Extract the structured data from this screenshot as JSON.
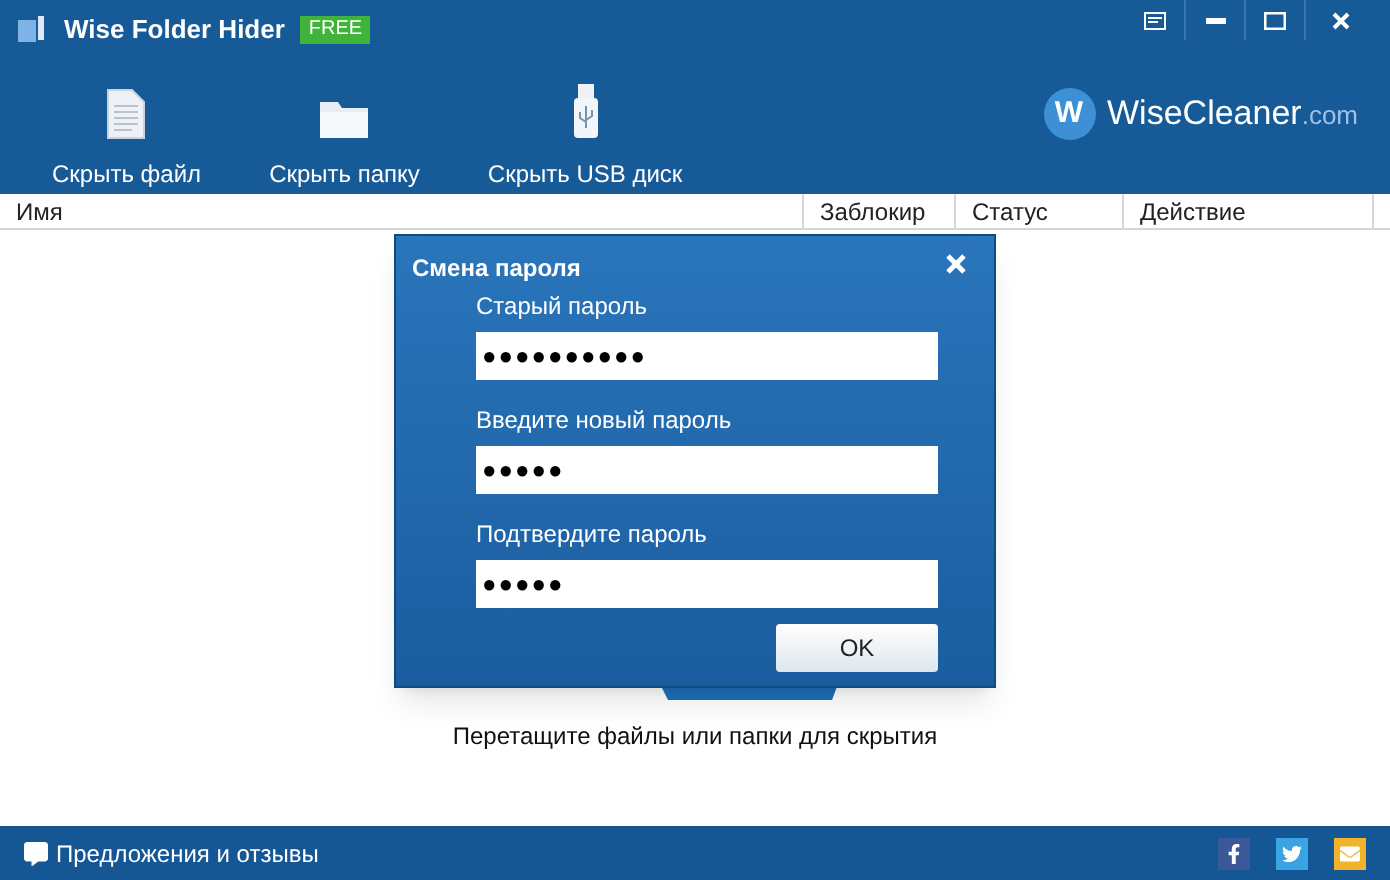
{
  "window": {
    "title": "Wise Folder Hider",
    "badge": "FREE"
  },
  "toolbar": [
    {
      "kind": "file",
      "label": "Скрыть файл"
    },
    {
      "kind": "folder",
      "label": "Скрыть папку"
    },
    {
      "kind": "usb",
      "label": "Скрыть USB диск"
    }
  ],
  "logo": {
    "letter": "W",
    "name": "WiseCleaner",
    "suffix": ".com"
  },
  "table": {
    "columns": [
      "Имя",
      "Заблокир",
      "Статус",
      "Действие"
    ]
  },
  "drop_hint": "Перетащите файлы или папки для скрытия",
  "dialog": {
    "title": "Смена пароля",
    "fields": [
      {
        "label": "Старый пароль",
        "value": "●●●●●●●●●●"
      },
      {
        "label": "Введите новый пароль",
        "value": "●●●●●"
      },
      {
        "label": "Подтвердите пароль",
        "value": "●●●●●"
      }
    ],
    "button": "OK"
  },
  "status_bar": {
    "feedback": "Предложения и отзывы"
  }
}
